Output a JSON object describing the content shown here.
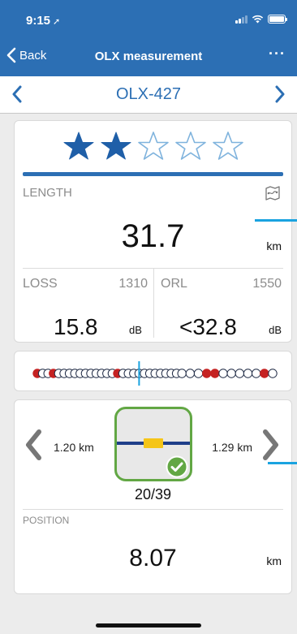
{
  "status_bar": {
    "time": "9:15",
    "location_icon": "location-arrow-icon"
  },
  "nav": {
    "back_label": "Back",
    "title": "OLX measurement",
    "more_label": "···"
  },
  "selector": {
    "title": "OLX-427"
  },
  "rating": {
    "score": 2,
    "max": 5,
    "filled_color": "#1f5fa8"
  },
  "length": {
    "label": "LENGTH",
    "value": "31.7",
    "unit": "km"
  },
  "loss": {
    "label": "LOSS",
    "wavelength": "1310",
    "value": "15.8",
    "unit": "dB"
  },
  "orl": {
    "label": "ORL",
    "wavelength": "1550",
    "value": "<32.8",
    "unit": "dB"
  },
  "event_map": {
    "event_count": 39,
    "current_event": 20,
    "failed_events": [
      1,
      4,
      16,
      31,
      32,
      38
    ],
    "line_color": "#1f2a44",
    "fail_color": "#c52222",
    "cursor_color": "#1aa3e0"
  },
  "position_nav": {
    "prev_distance": "1.20 km",
    "next_distance": "1.29 km",
    "counter": "20/39",
    "status": "pass",
    "accent_color": "#62a744"
  },
  "position": {
    "label": "POSITION",
    "value": "8.07",
    "unit": "km"
  },
  "colors": {
    "brand": "#2c6fb4",
    "pass": "#62a744",
    "fail": "#c52222"
  }
}
